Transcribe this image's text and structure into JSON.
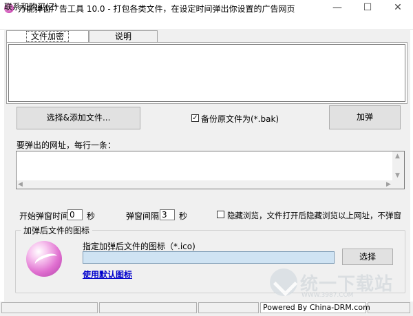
{
  "window": {
    "title": "万能弹窗广告工具 10.0 - 打包各类文件，在设定时间弹出你设置的广告网页",
    "minimize_glyph": "—",
    "maximize_glyph": "☐",
    "close_glyph": "✕"
  },
  "menu": {
    "items": [
      {
        "label": "联系和购买(Z)"
      }
    ]
  },
  "tabs": [
    {
      "label": "文件加密",
      "active": true
    },
    {
      "label": "说明",
      "active": false
    }
  ],
  "file_section": {
    "add_file_button": "选择&添加文件...",
    "backup_checkbox_label": "备份原文件为(*.bak)",
    "backup_checked": true,
    "check_glyph": "✓",
    "encrypt_button": "加弹"
  },
  "url_section": {
    "label": "要弹出的网址，每行一条：",
    "value": "",
    "scroll_left": "◀",
    "scroll_right": "▶",
    "scroll_up": "▲",
    "scroll_down": "▼"
  },
  "timing": {
    "start_label": "开始弹窗时间",
    "start_value": "0",
    "start_unit": "秒",
    "interval_label": "弹窗间隔",
    "interval_value": "3",
    "interval_unit": "秒",
    "hidden_browse_label": "隐藏浏览，文件打开后隐藏浏览以上网址，不弹窗",
    "hidden_browse_checked": false
  },
  "icon_group": {
    "title": "加弹后文件的图标",
    "field_label": "指定加弹后文件的图标（*.ico)",
    "field_value": "",
    "choose_button": "选择",
    "default_icon_link": "使用默认图标"
  },
  "statusbar": {
    "cells": [
      "",
      "",
      "",
      "Powered By China-DRM.com",
      ""
    ]
  },
  "watermark": {
    "text": "统一下载站",
    "sub": "WWW.3987.COM"
  }
}
